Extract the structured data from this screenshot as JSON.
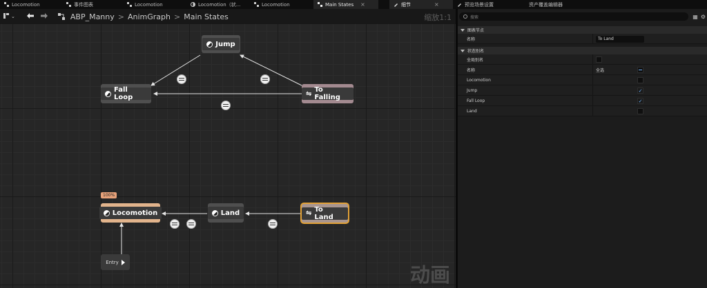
{
  "tabs": [
    {
      "label": "Locomotion",
      "active": false,
      "close": ""
    },
    {
      "label": "事件图表",
      "active": false,
      "close": ""
    },
    {
      "label": "Locomotion",
      "active": false,
      "close": ""
    },
    {
      "label": "Locomotion（状...",
      "active": false,
      "close": ""
    },
    {
      "label": "Locomotion",
      "active": false,
      "close": ""
    },
    {
      "label": "Main States",
      "active": true,
      "close": "×"
    },
    {
      "label": "细节",
      "active": true,
      "close": "×"
    },
    {
      "label": "预览场景设置",
      "active": false,
      "close": ""
    },
    {
      "label": "资产覆盖编辑器",
      "active": false,
      "close": ""
    }
  ],
  "breadcrumb": {
    "items": [
      "ABP_Manny",
      "AnimGraph",
      "Main States"
    ],
    "separator": ">"
  },
  "zoom_label": "缩放1:1",
  "graph": {
    "nodes": {
      "jump": "Jump",
      "fall_loop": "Fall Loop",
      "to_falling": "To Falling",
      "locomotion": "Locomotion",
      "land": "Land",
      "to_land": "To Land",
      "entry": "Entry"
    },
    "locomotion_badge": "100%",
    "watermark": "动画"
  },
  "details": {
    "search_placeholder": "搜索",
    "categories": [
      {
        "label": "图表节点",
        "rows": [
          {
            "label": "名称",
            "type": "text",
            "value": "To Land"
          }
        ]
      },
      {
        "label": "状态别名",
        "rows": [
          {
            "label": "全局别名",
            "type": "checkbox",
            "checked": false
          },
          {
            "label": "名称",
            "type": "checkbox-all",
            "value": "全选",
            "checked": false
          },
          {
            "label": "Locomotion",
            "type": "checkbox",
            "checked": false
          },
          {
            "label": "Jump",
            "type": "checkbox",
            "checked": true
          },
          {
            "label": "Fall Loop",
            "type": "checkbox",
            "checked": true
          },
          {
            "label": "Land",
            "type": "checkbox",
            "checked": false
          }
        ]
      }
    ]
  },
  "colors": {
    "accent_blue": "#6fb4ff",
    "selected_outline": "#e2a136",
    "active_state": "#e2b48c",
    "conduit": "#a38a90"
  }
}
